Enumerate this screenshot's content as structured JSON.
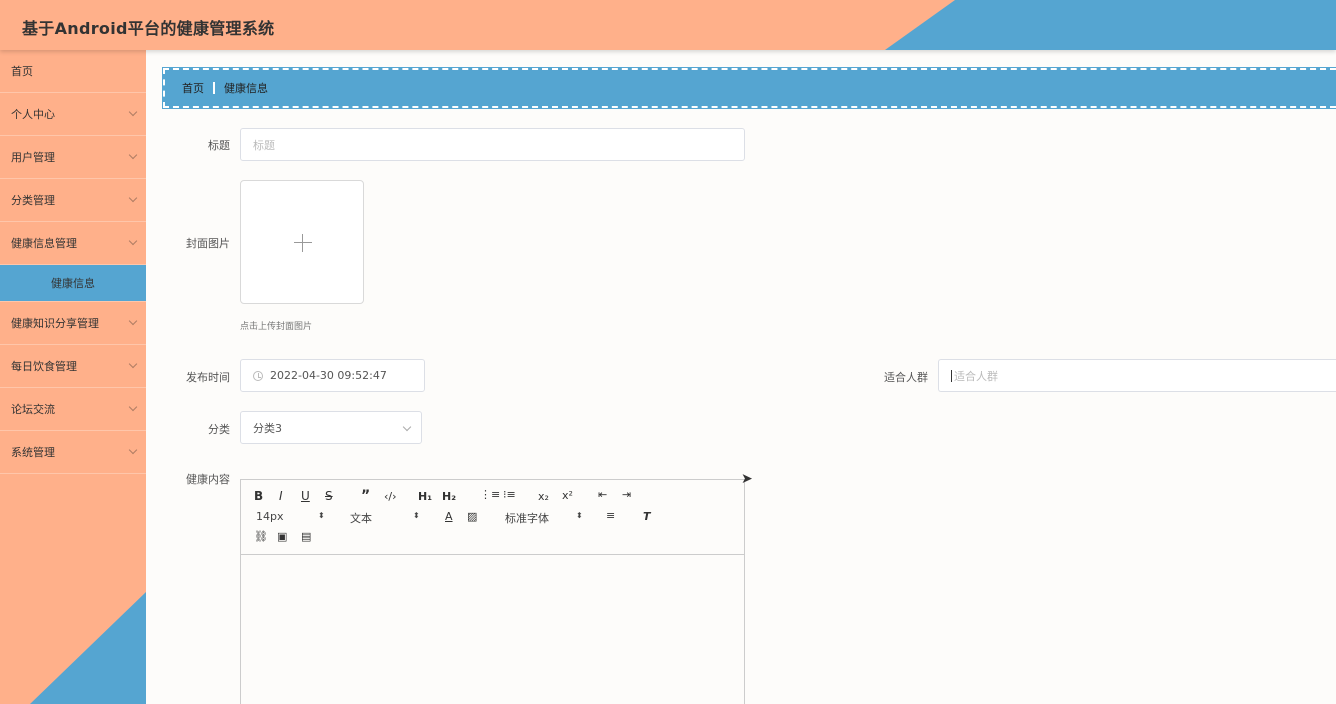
{
  "header": {
    "title": "基于Android平台的健康管理系统"
  },
  "sidebar": {
    "items": [
      {
        "label": "首页"
      },
      {
        "label": "个人中心"
      },
      {
        "label": "用户管理"
      },
      {
        "label": "分类管理"
      },
      {
        "label": "健康信息管理"
      },
      {
        "label": "健康知识分享管理"
      },
      {
        "label": "每日饮食管理"
      },
      {
        "label": "论坛交流"
      },
      {
        "label": "系统管理"
      }
    ],
    "subitem_active": "健康信息"
  },
  "breadcrumb": {
    "home": "首页",
    "current": "健康信息"
  },
  "form": {
    "title_label": "标题",
    "title_placeholder": "标题",
    "cover_label": "封面图片",
    "cover_hint": "点击上传封面图片",
    "publish_time_label": "发布时间",
    "publish_time_value": "2022-04-30 09:52:47",
    "audience_label": "适合人群",
    "audience_placeholder": "适合人群",
    "category_label": "分类",
    "category_value": "分类3",
    "content_label": "健康内容"
  },
  "editor": {
    "font_size": "14px",
    "format": "文本",
    "font_family": "标准字体"
  },
  "colors": {
    "accent_orange": "#ffb08a",
    "accent_blue": "#55a5d1"
  }
}
